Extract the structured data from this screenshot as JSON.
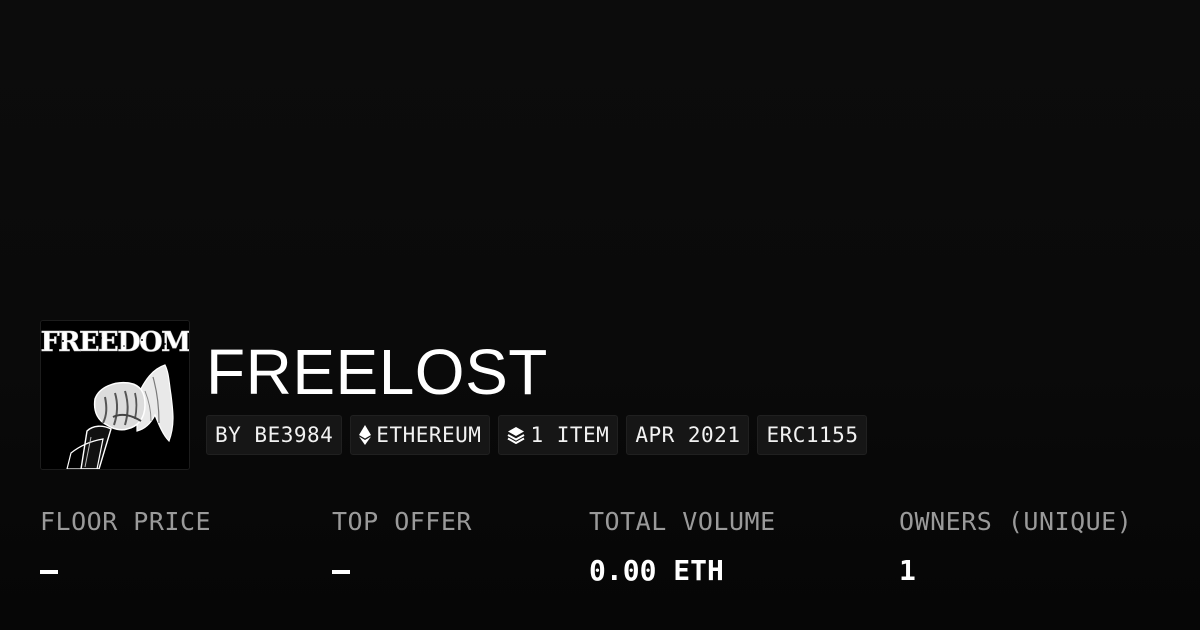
{
  "collection": {
    "logo_text": "FREEDOM",
    "name": "FREELOST"
  },
  "tags": [
    {
      "label": "BY BE3984",
      "icon": ""
    },
    {
      "label": "ETHEREUM",
      "icon": "ethereum-icon"
    },
    {
      "label": "1 ITEM",
      "icon": "layers-icon"
    },
    {
      "label": "APR 2021",
      "icon": ""
    },
    {
      "label": "ERC1155",
      "icon": ""
    }
  ],
  "stats": [
    {
      "label": "FLOOR PRICE",
      "value": "–"
    },
    {
      "label": "TOP OFFER",
      "value": "–"
    },
    {
      "label": "TOTAL VOLUME",
      "value": "0.00 ETH"
    },
    {
      "label": "OWNERS (UNIQUE)",
      "value": "1"
    }
  ],
  "colors": {
    "background": "#0a0a0a",
    "tag_background": "#161616",
    "label_gray": "#9a9a9a",
    "text": "#ffffff"
  }
}
